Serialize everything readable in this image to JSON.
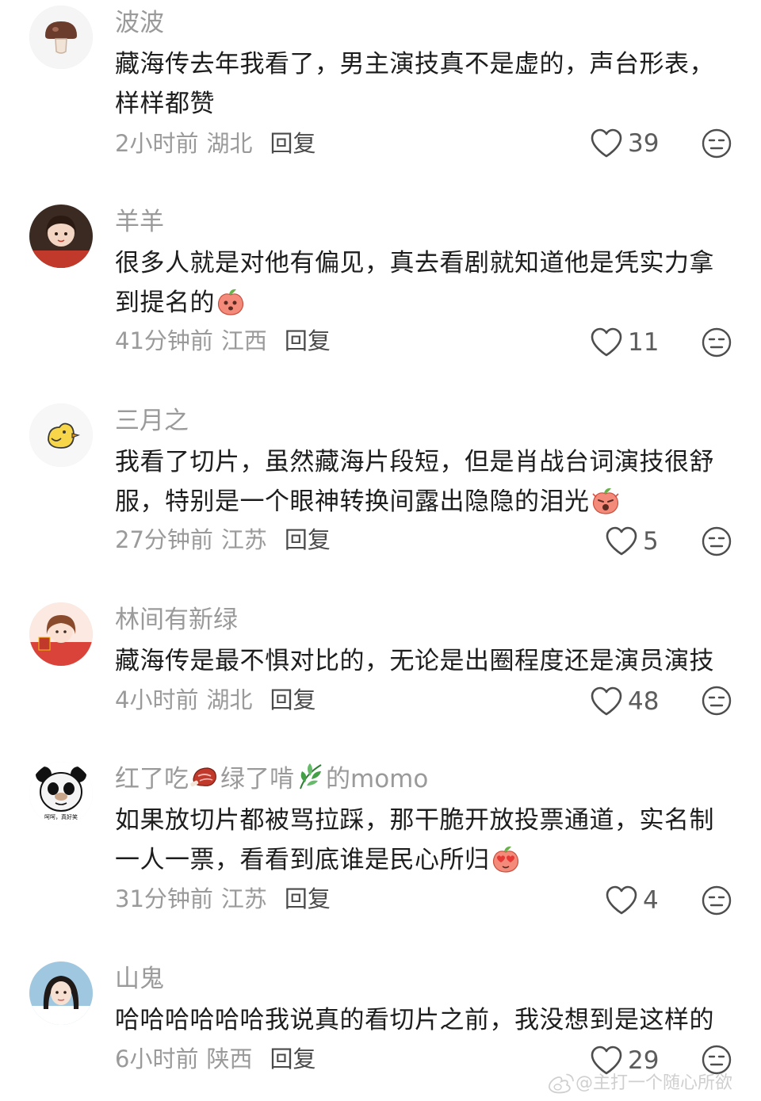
{
  "comments": [
    {
      "username": "波波",
      "avatar_icon": "mushroom-icon",
      "text": "藏海传去年我看了，男主演技真不是虚的，声台形表，样样都赞",
      "emoji": "",
      "time": "2小时前",
      "location": "湖北",
      "reply_label": "回复",
      "likes": "39"
    },
    {
      "username": "羊羊",
      "avatar_icon": "girl-photo-avatar",
      "text": "很多人就是对他有偏见，真去看剧就知道他是凭实力拿到提名的",
      "emoji": "peach-face-emoji",
      "time": "41分钟前",
      "location": "江西",
      "reply_label": "回复",
      "likes": "11"
    },
    {
      "username": "三月之",
      "avatar_icon": "chick-icon",
      "text": "我看了切片，虽然藏海片段短，但是肖战台词演技很舒服，特别是一个眼神转换间露出隐隐的泪光",
      "emoji": "peach-shocked-emoji",
      "time": "27分钟前",
      "location": "江苏",
      "reply_label": "回复",
      "likes": "5"
    },
    {
      "username": "林间有新绿",
      "avatar_icon": "illustrated-girl-avatar",
      "text": "藏海传是最不惧对比的，无论是出圈程度还是演员演技",
      "emoji": "",
      "time": "4小时前",
      "location": "湖北",
      "reply_label": "回复",
      "likes": "48"
    },
    {
      "username_parts": [
        "红了吃",
        "绿了啃",
        "的momo"
      ],
      "username_emojis": [
        "meat-emoji",
        "leaf-emoji"
      ],
      "avatar_icon": "panda-meme-avatar",
      "avatar_caption": "呵呵，真好笑",
      "text": "如果放切片都被骂拉踩，那干脆开放投票通道，实名制一人一票，看看到底谁是民心所归",
      "emoji": "peach-heart-eyes-emoji",
      "time": "31分钟前",
      "location": "江苏",
      "reply_label": "回复",
      "likes": "4"
    },
    {
      "username": "山鬼",
      "avatar_icon": "woman-photo-avatar",
      "text": "哈哈哈哈哈哈我说真的看切片之前，我没想到是这样的",
      "emoji": "",
      "time": "6小时前",
      "location": "陕西",
      "reply_label": "回复",
      "likes": "29"
    }
  ],
  "watermark": {
    "text": "@主打一个随心所欲",
    "icon": "weibo-icon"
  },
  "colors": {
    "username": "#9a9a9a",
    "body": "#1d1d1d",
    "meta": "#9a9a9a",
    "reply": "#4a4a4a",
    "icon": "#4d4d4d"
  }
}
